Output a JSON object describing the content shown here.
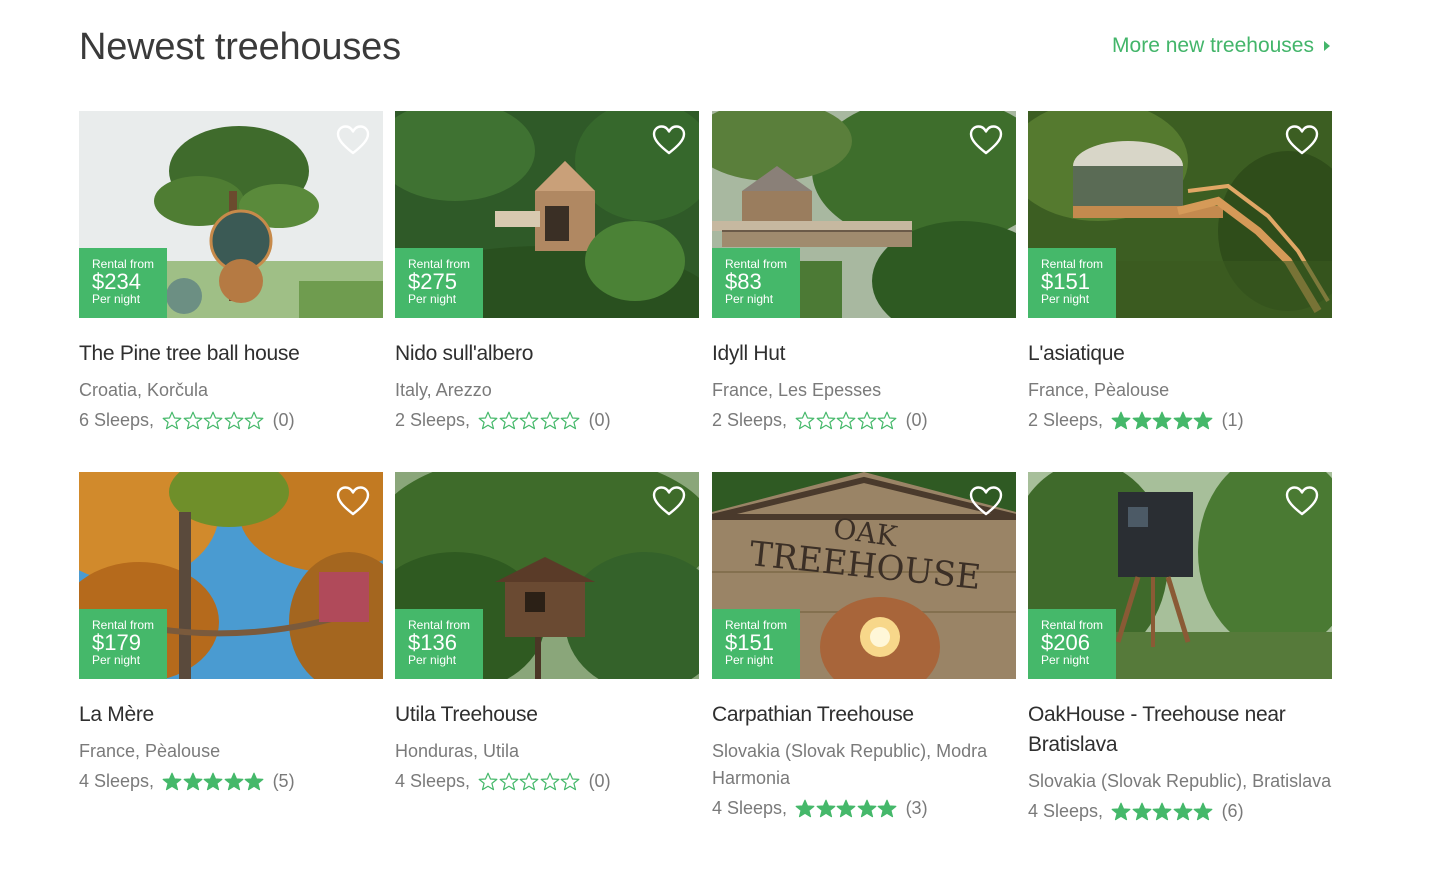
{
  "header": {
    "title": "Newest treehouses",
    "more_link": "More new treehouses"
  },
  "colors": {
    "accent": "#45b86a",
    "text_muted": "#7a7a7a"
  },
  "icons": {
    "favorite": "heart-outline-icon",
    "rating": "star-icon",
    "more": "caret-right-icon"
  },
  "listings": [
    {
      "title": "The Pine tree ball house",
      "location": "Croatia, Korčula",
      "sleeps": "6 Sleeps,",
      "rating": 0,
      "reviews": "(0)",
      "badge_top": "Rental from",
      "price": "$234",
      "badge_bottom": "Per night"
    },
    {
      "title": "Nido sull'albero",
      "location": "Italy, Arezzo",
      "sleeps": "2 Sleeps,",
      "rating": 0,
      "reviews": "(0)",
      "badge_top": "Rental from",
      "price": "$275",
      "badge_bottom": "Per night"
    },
    {
      "title": "Idyll Hut",
      "location": "France, Les Epesses",
      "sleeps": "2 Sleeps,",
      "rating": 0,
      "reviews": "(0)",
      "badge_top": "Rental from",
      "price": "$83",
      "badge_bottom": "Per night"
    },
    {
      "title": "L'asiatique",
      "location": "France, Pèalouse",
      "sleeps": "2 Sleeps,",
      "rating": 5,
      "reviews": "(1)",
      "badge_top": "Rental from",
      "price": "$151",
      "badge_bottom": "Per night"
    },
    {
      "title": "La Mère",
      "location": "France, Pèalouse",
      "sleeps": "4 Sleeps,",
      "rating": 5,
      "reviews": "(5)",
      "badge_top": "Rental from",
      "price": "$179",
      "badge_bottom": "Per night"
    },
    {
      "title": "Utila Treehouse",
      "location": "Honduras, Utila",
      "sleeps": "4 Sleeps,",
      "rating": 0,
      "reviews": "(0)",
      "badge_top": "Rental from",
      "price": "$136",
      "badge_bottom": "Per night"
    },
    {
      "title": "Carpathian Treehouse",
      "location": "Slovakia (Slovak Republic), Modra Harmonia",
      "sleeps": "4 Sleeps,",
      "rating": 5,
      "reviews": "(3)",
      "badge_top": "Rental from",
      "price": "$151",
      "badge_bottom": "Per night"
    },
    {
      "title": "OakHouse - Treehouse near Bratislava",
      "location": "Slovakia (Slovak Republic), Bratislava",
      "sleeps": "4 Sleeps,",
      "rating": 5,
      "reviews": "(6)",
      "badge_top": "Rental from",
      "price": "$206",
      "badge_bottom": "Per night"
    }
  ]
}
